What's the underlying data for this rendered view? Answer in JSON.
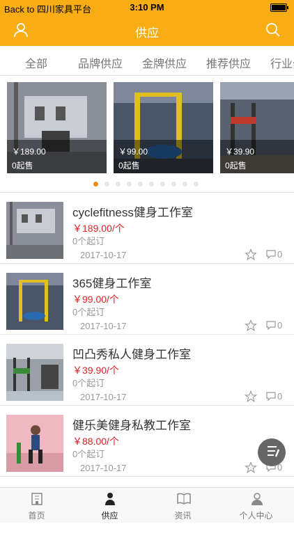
{
  "status_bar": {
    "back_label": "Back to 四川家具平台",
    "time": "3:10 PM"
  },
  "navbar": {
    "title": "供应"
  },
  "tabs": [
    "全部",
    "品牌供应",
    "金牌供应",
    "推荐供应",
    "行业分"
  ],
  "carousel": [
    {
      "price": "￥189.00",
      "moq": "0起售"
    },
    {
      "price": "￥99.00",
      "moq": "0起售"
    },
    {
      "price": "￥39.90",
      "moq": "0起售"
    }
  ],
  "carousel_dots": {
    "count": 10,
    "active_index": 0
  },
  "items": [
    {
      "name": "cyclefitness健身工作室",
      "price": "￥189.00/个",
      "moq": "0个起订",
      "date": "2017-10-17",
      "comments": "0"
    },
    {
      "name": "365健身工作室",
      "price": "￥99.00/个",
      "moq": "0个起订",
      "date": "2017-10-17",
      "comments": "0"
    },
    {
      "name": "凹凸秀私人健身工作室",
      "price": "￥39.90/个",
      "moq": "0个起订",
      "date": "2017-10-17",
      "comments": "0"
    },
    {
      "name": "健乐美健身私教工作室",
      "price": "￥88.00/个",
      "moq": "0个起订",
      "date": "2017-10-17",
      "comments": "0"
    }
  ],
  "bottom_nav": [
    {
      "label": "首页",
      "icon": "home-icon"
    },
    {
      "label": "供应",
      "icon": "supply-icon"
    },
    {
      "label": "资讯",
      "icon": "news-icon"
    },
    {
      "label": "个人中心",
      "icon": "profile-icon"
    }
  ],
  "colors": {
    "brand": "#f9ad14",
    "price": "#e02020",
    "active_dot": "#f08c1d"
  }
}
